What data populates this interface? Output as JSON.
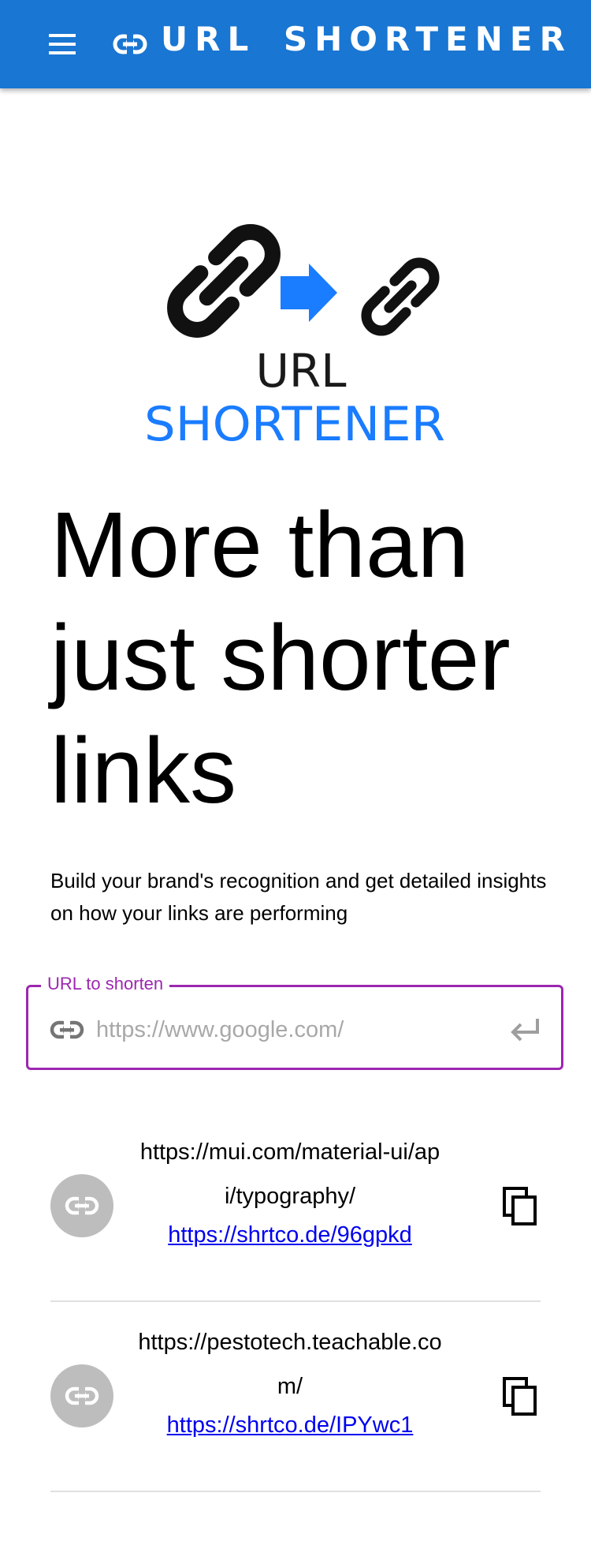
{
  "app_bar": {
    "title": "URL SHORTENER",
    "menu_icon": "menu-icon",
    "brand_icon": "link-icon",
    "background": "#1976d2"
  },
  "logo": {
    "line1": "URL",
    "line2": "SHORTENER",
    "arrow_color": "#1a7cff"
  },
  "hero": {
    "title": "More than just shorter links",
    "subtitle": "Build your brand's recognition and get detailed insights on how your links are performing"
  },
  "url_field": {
    "label": "URL to shorten",
    "placeholder": "https://www.google.com/",
    "value": "",
    "start_icon": "link-icon",
    "end_icon": "enter-icon",
    "accent": "#9c27b0"
  },
  "links": [
    {
      "original": "https://mui.com/material-ui/api/typography/",
      "short": "https://shrtco.de/96gpkd",
      "avatar_icon": "link-icon",
      "action_icon": "copy-icon"
    },
    {
      "original": "https://pestotech.teachable.com/",
      "short": "https://shrtco.de/IPYwc1",
      "avatar_icon": "link-icon",
      "action_icon": "copy-icon"
    }
  ]
}
